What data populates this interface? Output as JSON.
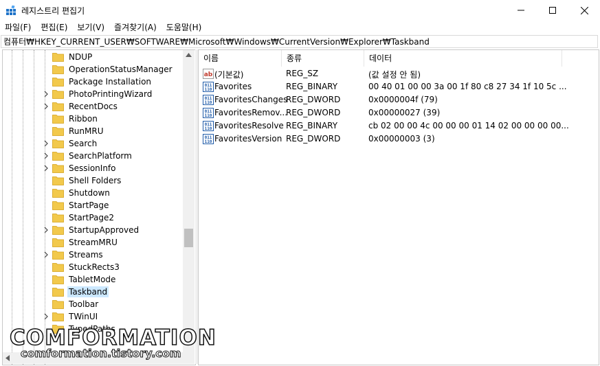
{
  "window": {
    "title": "레지스트리 편집기",
    "minimize_icon": "minimize-icon",
    "maximize_icon": "maximize-icon",
    "close_icon": "close-icon"
  },
  "menu": [
    "파일(F)",
    "편집(E)",
    "보기(V)",
    "즐겨찾기(A)",
    "도움말(H)"
  ],
  "address": "컴퓨터₩HKEY_CURRENT_USER₩SOFTWARE₩Microsoft₩Windows₩CurrentVersion₩Explorer₩Taskband",
  "tree": {
    "items": [
      {
        "label": "NDUP",
        "expandable": false
      },
      {
        "label": "OperationStatusManager",
        "expandable": false
      },
      {
        "label": "Package Installation",
        "expandable": false
      },
      {
        "label": "PhotoPrintingWizard",
        "expandable": true
      },
      {
        "label": "RecentDocs",
        "expandable": true
      },
      {
        "label": "Ribbon",
        "expandable": false
      },
      {
        "label": "RunMRU",
        "expandable": false
      },
      {
        "label": "Search",
        "expandable": true
      },
      {
        "label": "SearchPlatform",
        "expandable": true
      },
      {
        "label": "SessionInfo",
        "expandable": true
      },
      {
        "label": "Shell Folders",
        "expandable": false
      },
      {
        "label": "Shutdown",
        "expandable": false
      },
      {
        "label": "StartPage",
        "expandable": false
      },
      {
        "label": "StartPage2",
        "expandable": false
      },
      {
        "label": "StartupApproved",
        "expandable": true
      },
      {
        "label": "StreamMRU",
        "expandable": false
      },
      {
        "label": "Streams",
        "expandable": true
      },
      {
        "label": "StuckRects3",
        "expandable": false
      },
      {
        "label": "TabletMode",
        "expandable": false
      },
      {
        "label": "Taskband",
        "expandable": false,
        "selected": true
      },
      {
        "label": "Toolbar",
        "expandable": false
      },
      {
        "label": "TWinUI",
        "expandable": true
      },
      {
        "label": "TypedPaths",
        "expandable": false
      }
    ],
    "colors": {
      "folder": "#f2c94c",
      "selected": "#cce8ff"
    }
  },
  "values_pane": {
    "headers": {
      "name": "이름",
      "type": "종류",
      "data": "데이터"
    },
    "rows": [
      {
        "icon": "string-value-icon",
        "name": "(기본값)",
        "type": "REG_SZ",
        "data": "(값 설정 안 됨)"
      },
      {
        "icon": "binary-value-icon",
        "name": "Favorites",
        "type": "REG_BINARY",
        "data": "00 40 01 00 00 3a 00 1f 80 c8 27 34 1f 10 5c ..."
      },
      {
        "icon": "binary-value-icon",
        "name": "FavoritesChanges",
        "type": "REG_DWORD",
        "data": "0x0000004f (79)"
      },
      {
        "icon": "binary-value-icon",
        "name": "FavoritesRemov...",
        "type": "REG_DWORD",
        "data": "0x00000027 (39)"
      },
      {
        "icon": "binary-value-icon",
        "name": "FavoritesResolve",
        "type": "REG_BINARY",
        "data": "cb 02 00 00 4c 00 00 00 01 14 02 00 00 00 00..."
      },
      {
        "icon": "binary-value-icon",
        "name": "FavoritesVersion",
        "type": "REG_DWORD",
        "data": "0x00000003 (3)"
      }
    ]
  },
  "watermark": {
    "line1": "COMFORMATION",
    "line2": "comformation.tistory.com"
  }
}
